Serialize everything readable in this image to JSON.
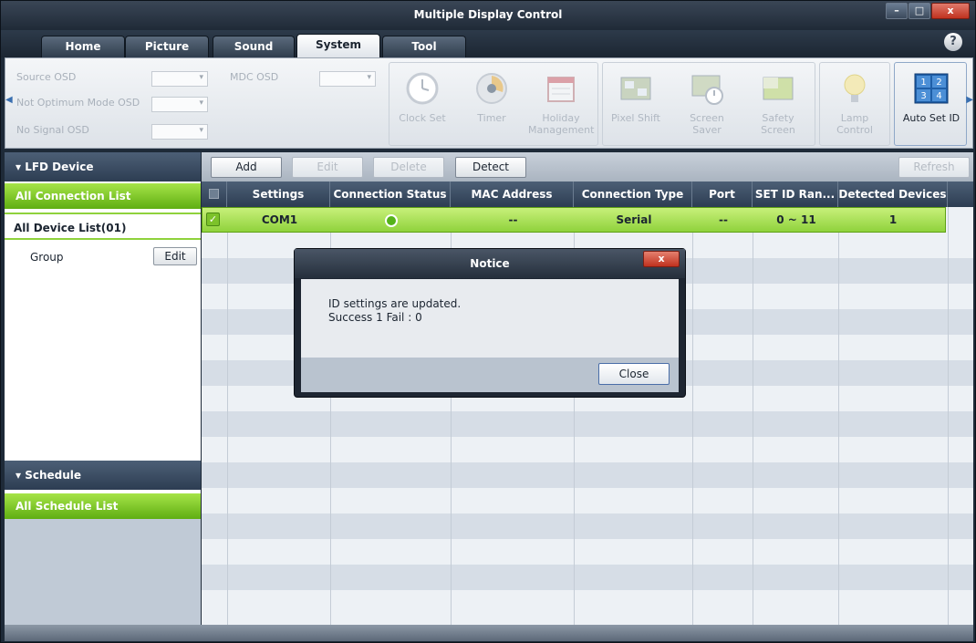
{
  "window": {
    "title": "Multiple Display Control"
  },
  "tabs": [
    {
      "label": "Home"
    },
    {
      "label": "Picture"
    },
    {
      "label": "Sound"
    },
    {
      "label": "System"
    },
    {
      "label": "Tool"
    }
  ],
  "active_tab": "System",
  "ribbon": {
    "osd": {
      "source_osd_label": "Source OSD",
      "not_optimum_label": "Not Optimum Mode OSD",
      "no_signal_label": "No Signal OSD",
      "mdc_osd_label": "MDC OSD"
    },
    "items": [
      {
        "label": "Clock Set",
        "enabled": false
      },
      {
        "label": "Timer",
        "enabled": false
      },
      {
        "label": "Holiday Management",
        "enabled": false
      },
      {
        "label": "Pixel Shift",
        "enabled": false
      },
      {
        "label": "Screen Saver",
        "enabled": false
      },
      {
        "label": "Safety Screen",
        "enabled": false
      },
      {
        "label": "Lamp Control",
        "enabled": false
      },
      {
        "label": "Auto Set ID",
        "enabled": true
      }
    ],
    "auto_set_id_digits": [
      "1",
      "2",
      "3",
      "4"
    ]
  },
  "left_panel": {
    "lfd_header": "LFD Device",
    "all_connection_list": "All Connection List",
    "all_device_list": "All Device List(01)",
    "group_label": "Group",
    "group_edit": "Edit",
    "schedule_header": "Schedule",
    "all_schedule_list": "All Schedule List"
  },
  "toolbar": {
    "add": "Add",
    "edit": "Edit",
    "delete": "Delete",
    "detect": "Detect",
    "refresh": "Refresh"
  },
  "table": {
    "columns": [
      "Settings",
      "Connection Status",
      "MAC Address",
      "Connection Type",
      "Port",
      "SET ID Ran...",
      "Detected Devices"
    ],
    "rows": [
      {
        "checked": true,
        "settings": "COM1",
        "status": "connected",
        "mac": "--",
        "type": "Serial",
        "port": "--",
        "set_id_range": "0 ~ 11",
        "detected": "1"
      }
    ]
  },
  "dialog": {
    "title": "Notice",
    "line1": "ID settings are updated.",
    "line2": "Success  1  Fail : 0",
    "close_button": "Close"
  },
  "colors": {
    "accent_green": "#8fd23c",
    "header_dark": "#2d3d52",
    "close_red": "#c0321f"
  }
}
